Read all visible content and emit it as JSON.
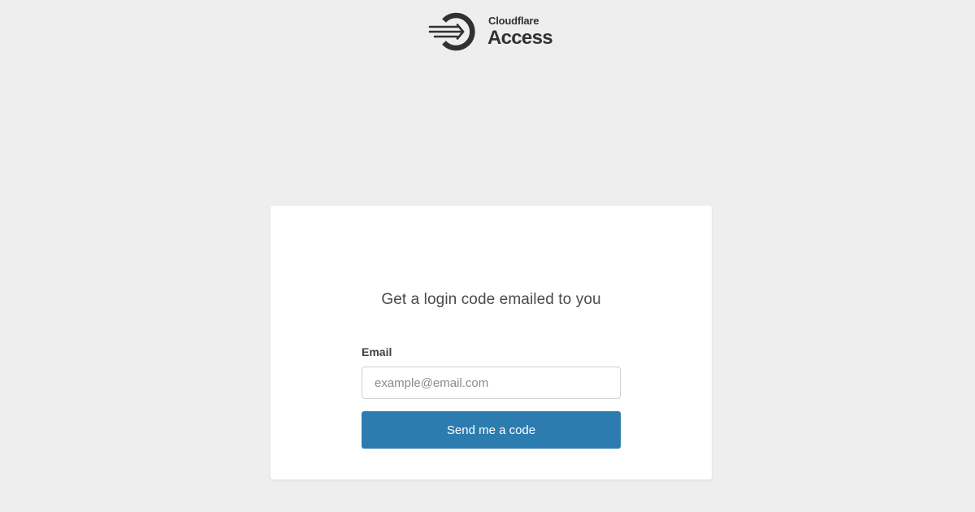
{
  "header": {
    "brand": "Cloudflare",
    "product": "Access",
    "logo_icon": "cloudflare-access-logo-icon"
  },
  "login_card": {
    "title": "Get a login code emailed to you",
    "email_label": "Email",
    "email_placeholder": "example@email.com",
    "email_value": "",
    "submit_label": "Send me a code"
  },
  "colors": {
    "background": "#eeeeee",
    "card": "#ffffff",
    "button": "#2c7cb0",
    "logo": "#313131"
  }
}
